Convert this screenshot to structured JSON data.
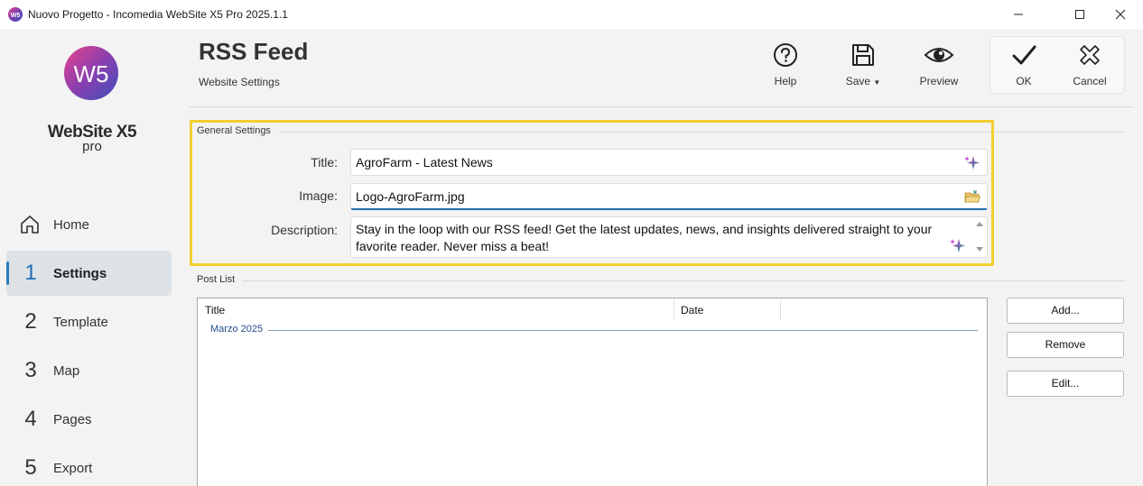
{
  "window": {
    "title": "Nuovo Progetto - Incomedia WebSite X5 Pro 2025.1.1",
    "icon": "websitex5-app-icon"
  },
  "logo": {
    "mark": "W5",
    "brand": "WebSite X5",
    "edition": "pro",
    "colors": [
      "#e8428c",
      "#7a3fb0",
      "#3e4fb8"
    ]
  },
  "nav": {
    "home": "Home",
    "items": [
      {
        "num": "1",
        "label": "Settings",
        "active": true
      },
      {
        "num": "2",
        "label": "Template",
        "active": false
      },
      {
        "num": "3",
        "label": "Map",
        "active": false
      },
      {
        "num": "4",
        "label": "Pages",
        "active": false
      },
      {
        "num": "5",
        "label": "Export",
        "active": false
      }
    ]
  },
  "header": {
    "title": "RSS Feed",
    "breadcrumb": "Website Settings"
  },
  "toolbar": {
    "help": "Help",
    "save": "Save",
    "preview": "Preview",
    "ok": "OK",
    "cancel": "Cancel"
  },
  "general": {
    "legend": "General Settings",
    "title_label": "Title:",
    "title_value": "AgroFarm - Latest News",
    "image_label": "Image:",
    "image_value": "Logo-AgroFarm.jpg",
    "description_label": "Description:",
    "description_value": "Stay in the loop with our RSS feed! Get the latest updates, news, and insights delivered straight to your favorite reader. Never miss a beat!",
    "highlight_color": "#f2cf2f"
  },
  "post_list": {
    "legend": "Post List",
    "columns": [
      "Title",
      "Date"
    ],
    "group": "Marzo 2025",
    "buttons": {
      "add": "Add...",
      "remove": "Remove",
      "edit": "Edit..."
    }
  },
  "colors": {
    "accent": "#1f6fb3",
    "active_nav_bg": "#dde2e7"
  }
}
